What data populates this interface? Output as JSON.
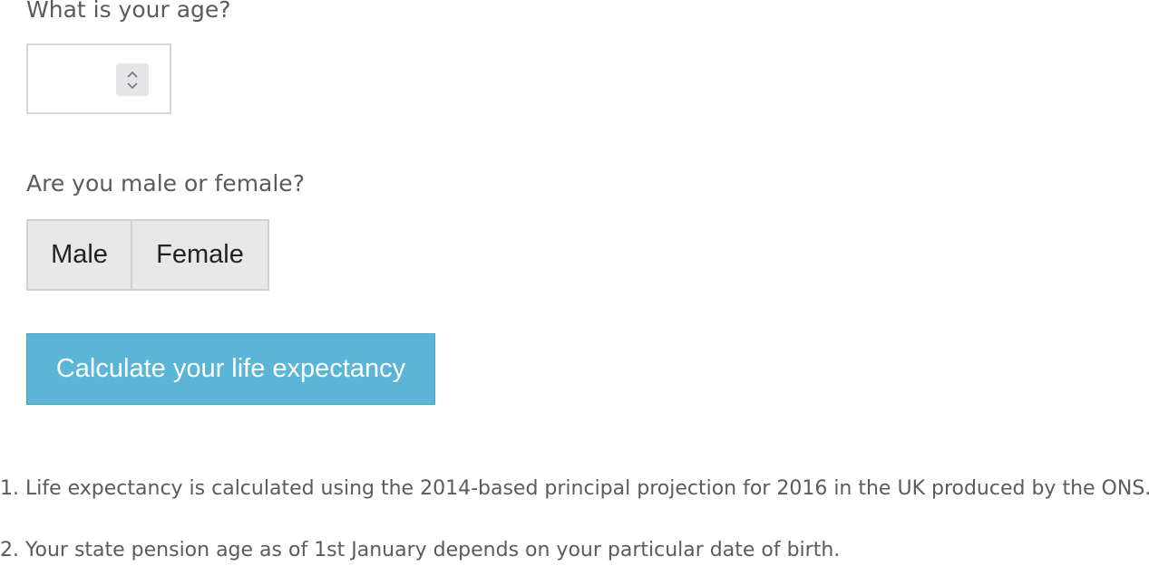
{
  "age_question": "What is your age?",
  "age_input": {
    "value": "",
    "placeholder": ""
  },
  "sex_question": "Are you male or female?",
  "sex_options": {
    "male": "Male",
    "female": "Female"
  },
  "calculate_label": "Calculate your life expectancy",
  "notes": [
    "1. Life expectancy is calculated using the 2014-based principal projection for 2016 in the UK produced by the ONS.",
    "2. Your state pension age as of 1st January depends on your particular date of birth."
  ],
  "colors": {
    "primary_button": "#5bb5d6",
    "segment_button": "#e8e8e8",
    "text": "#5b5b5b"
  },
  "icons": {
    "spinner_up": "chevron-up-icon",
    "spinner_down": "chevron-down-icon"
  }
}
